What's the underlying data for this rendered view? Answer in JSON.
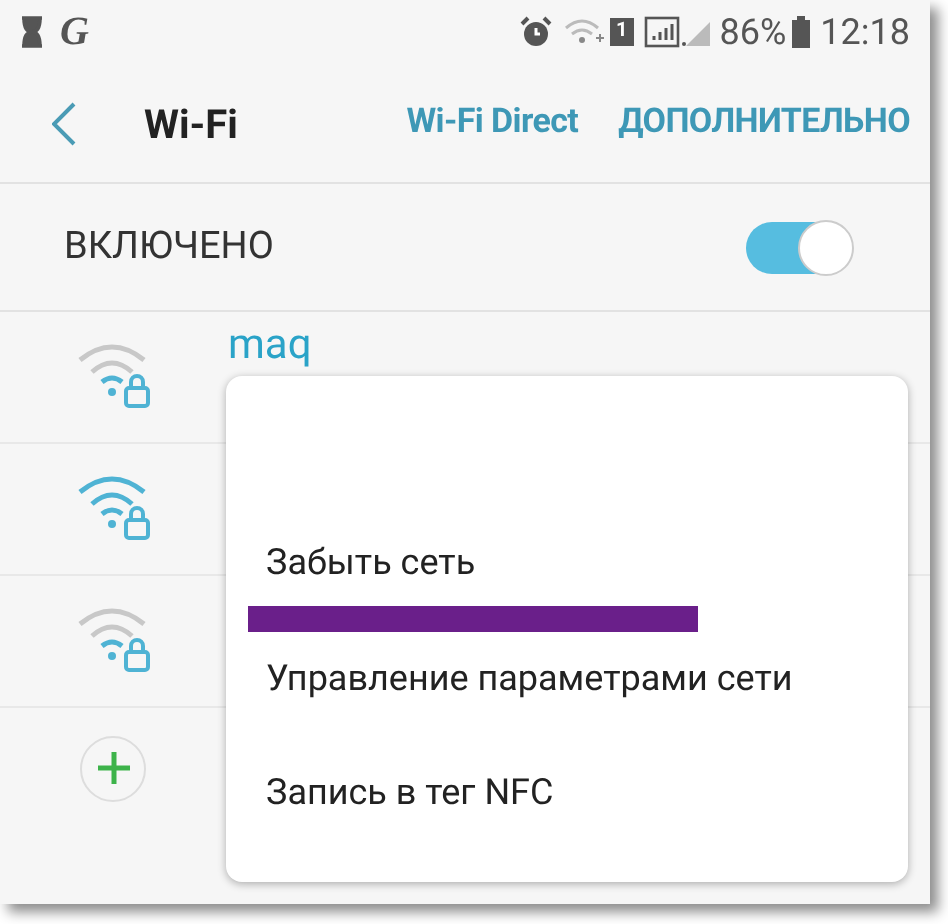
{
  "status_bar": {
    "app_letter": "G",
    "sim": "1",
    "battery": "86%",
    "time": "12:18"
  },
  "header": {
    "title": "Wi-Fi",
    "actions": [
      "Wi-Fi Direct",
      "ДОПОЛНИТЕЛЬНО"
    ]
  },
  "wifi_switch": {
    "label": "ВКЛЮЧЕНО",
    "on": true
  },
  "networks": [
    {
      "name": "maq",
      "strong": false
    },
    {
      "strong": true
    },
    {
      "strong": false
    }
  ],
  "context_menu": {
    "items": [
      {
        "label": "Забыть сеть",
        "underlined": true
      },
      {
        "label": "Управление параметрами сети",
        "underlined": false
      },
      {
        "label": "Запись в тег NFC",
        "underlined": false
      }
    ]
  }
}
